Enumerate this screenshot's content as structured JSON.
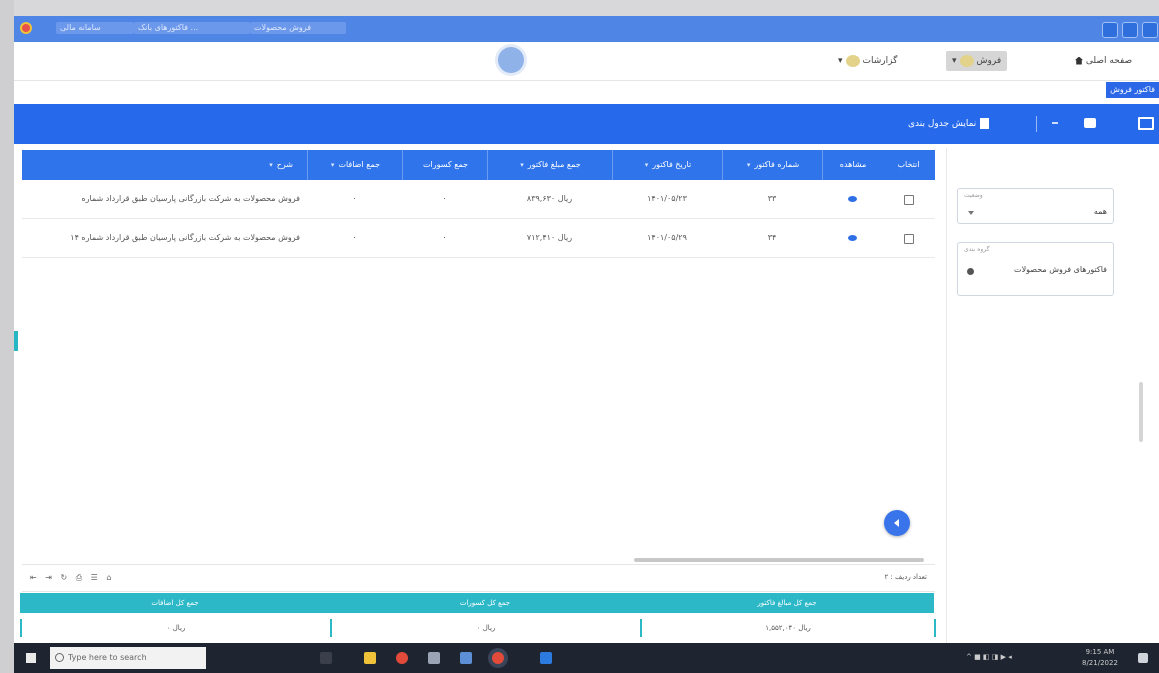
{
  "browser": {
    "tabs": [
      "سامانه مالی",
      "فاکتورهای بانک ...",
      "فروش محصولات"
    ]
  },
  "app": {
    "nav": {
      "home": "صفحه اصلی",
      "sales": "فروش",
      "reports": "گزارشات"
    },
    "right_tag": "فاکتور فروش"
  },
  "toolbar": {
    "title": "نمایش جدول بندی"
  },
  "filters": {
    "status_label": "وضعیت",
    "status_value": "همه",
    "category_label": "گروه بندی",
    "category_value": "فاکتورهای فروش محصولات"
  },
  "grid": {
    "columns": [
      "انتخاب",
      "مشاهده",
      "شماره فاکتور",
      "تاریخ فاکتور",
      "جمع مبلغ فاکتور",
      "جمع کسورات",
      "جمع اضافات",
      "شرح"
    ],
    "rows": [
      {
        "number": "۳۳",
        "date": "۱۴۰۱/۰۵/۲۳",
        "total": "۸۳۹,۶۳۰ ریال",
        "deductions": "۰",
        "additions": "۰",
        "description": "فروش محصولات به شرکت بازرگانی پارسیان طبق قرارداد شماره"
      },
      {
        "number": "۳۴",
        "date": "۱۴۰۱/۰۵/۲۹",
        "total": "۷۱۲,۴۱۰ ریال",
        "deductions": "۰",
        "additions": "۰",
        "description": "فروش محصولات به شرکت بازرگانی پارسیان طبق قرارداد شماره ۱۴"
      }
    ]
  },
  "pager": {
    "text": "تعداد ردیف : ۲",
    "icons": "⇤ ⇥ ↻ ⎙ ☰ ⌂"
  },
  "summary": {
    "headers": [
      "جمع کل مبالغ فاکتور",
      "جمع کل کسورات",
      "جمع کل اضافات"
    ],
    "values": [
      "۱,۵۵۲,۰۴۰ ریال",
      "۰ ریال",
      "۰ ریال"
    ]
  },
  "taskbar": {
    "search_placeholder": "Type here to search",
    "clock_time": "9:15 AM",
    "clock_date": "8/21/2022"
  },
  "colors": {
    "accent": "#2669ea",
    "header": "#2f74ea",
    "summary": "#2db8c8"
  }
}
